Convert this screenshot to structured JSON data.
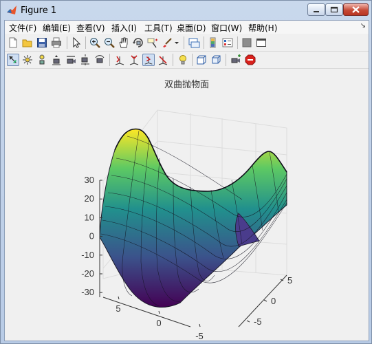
{
  "window": {
    "title": "Figure 1"
  },
  "menu": [
    "文件(F)",
    "编辑(E)",
    "查看(V)",
    "插入(I)",
    "工具(T)",
    "桌面(D)",
    "窗口(W)",
    "帮助(H)"
  ],
  "toolbar1_icons": [
    "new-figure-icon",
    "open-file-icon",
    "save-icon",
    "print-icon",
    "pointer-icon",
    "zoom-in-icon",
    "zoom-out-icon",
    "pan-hand-icon",
    "rotate-3d-icon",
    "data-cursor-icon",
    "brush-icon",
    "brush-dropdown-icon",
    "link-plot-icon",
    "insert-colorbar-icon",
    "insert-legend-icon",
    "hide-plot-tools-icon",
    "show-plot-tools-icon"
  ],
  "toolbar2_icons": [
    "edit-plot-icon",
    "orbit-camera-icon",
    "orbit-scene-light-icon",
    "pan-tilt-camera-icon",
    "move-camera-icon",
    "dolly-camera-icon",
    "roll-camera-icon",
    "x-principal-axis-icon",
    "y-principal-axis-icon",
    "z-principal-axis-icon",
    "no-principal-axis-icon",
    "toggle-scene-light-icon",
    "orthographic-projection-icon",
    "perspective-projection-icon",
    "reset-camera-icon",
    "stop-camera-icon"
  ],
  "plot": {
    "title": "双曲抛物面",
    "z_ticks": [
      "30",
      "20",
      "10",
      "0",
      "-10",
      "-20",
      "-30"
    ],
    "x_ticks": [
      "5",
      "0",
      "-5"
    ],
    "y_ticks": [
      "5",
      "0",
      "-5"
    ],
    "surface": "z = x^2 - y^2",
    "colormap": [
      "#440154",
      "#3b528b",
      "#21908d",
      "#5dc963",
      "#fde725"
    ]
  }
}
